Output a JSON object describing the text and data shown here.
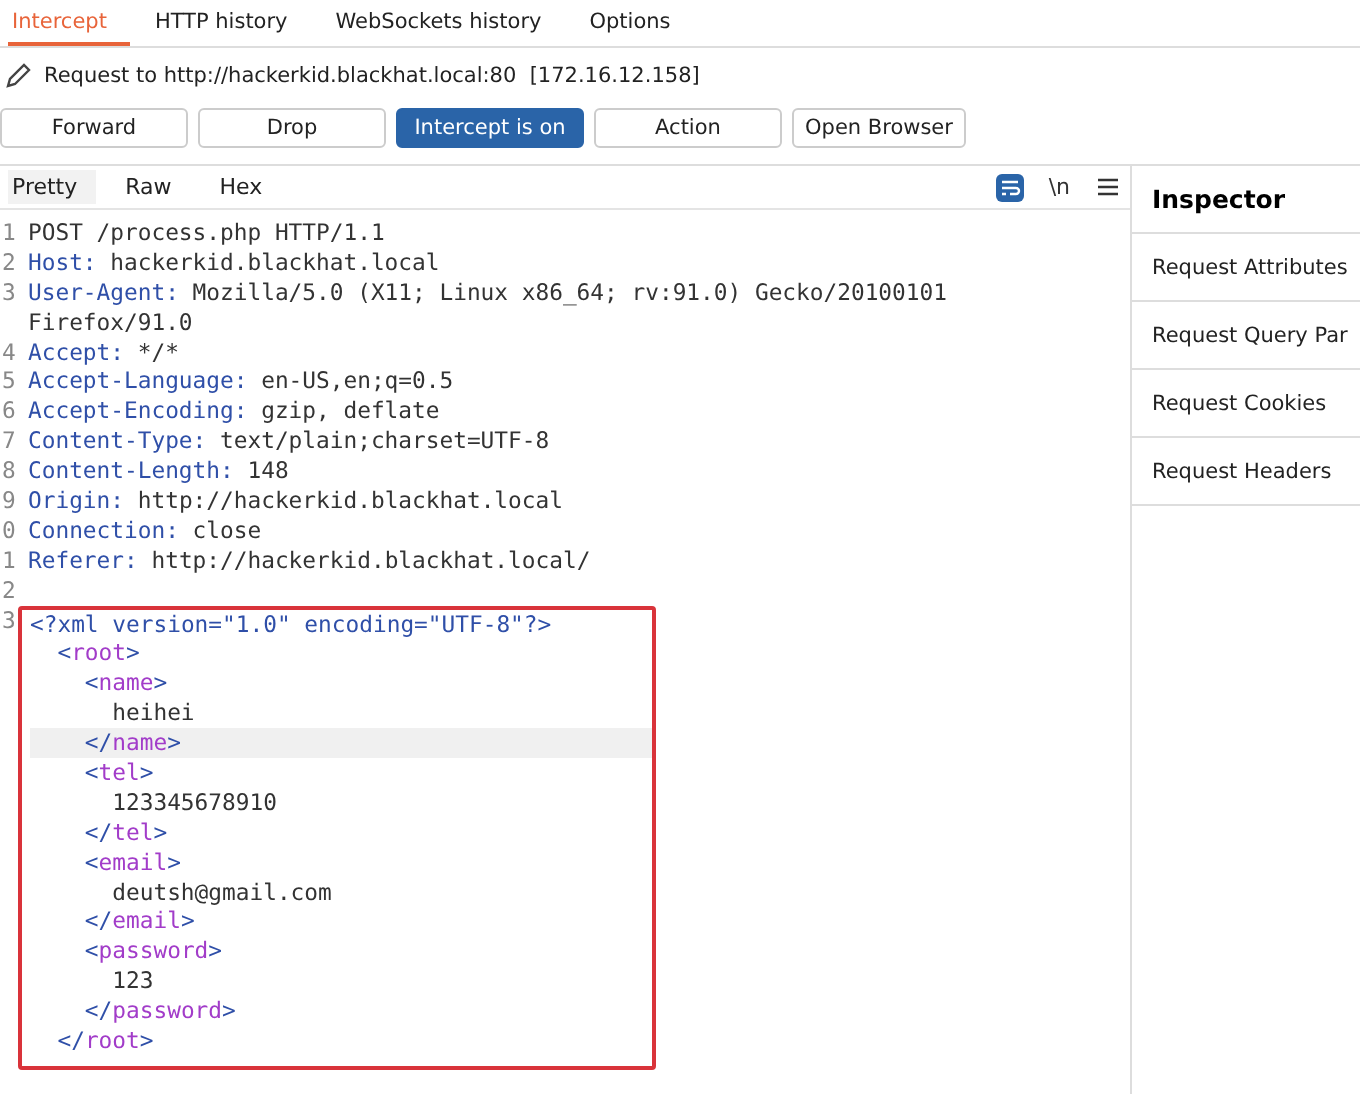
{
  "tabs": [
    {
      "label": "Intercept",
      "selected": true
    },
    {
      "label": "HTTP history",
      "selected": false
    },
    {
      "label": "WebSockets history",
      "selected": false
    },
    {
      "label": "Options",
      "selected": false
    }
  ],
  "request_info": "Request to http://hackerkid.blackhat.local:80  [172.16.12.158]",
  "buttons": [
    {
      "label": "Forward",
      "selected": false
    },
    {
      "label": "Drop",
      "selected": false
    },
    {
      "label": "Intercept is on",
      "selected": true
    },
    {
      "label": "Action",
      "selected": false
    },
    {
      "label": "Open Browser",
      "selected": false
    }
  ],
  "editor_tabs": [
    {
      "label": "Pretty",
      "selected": true
    },
    {
      "label": "Raw",
      "selected": false
    },
    {
      "label": "Hex",
      "selected": false
    }
  ],
  "newline_toggle": "\\n",
  "header_lines": [
    {
      "number": "1",
      "segments": [
        {
          "kind": "text",
          "text": "POST /process.php HTTP/1.1"
        }
      ]
    },
    {
      "number": "2",
      "segments": [
        {
          "kind": "key",
          "text": "Host:"
        },
        {
          "kind": "text",
          "text": " hackerkid.blackhat.local"
        }
      ]
    },
    {
      "number": "3",
      "segments": [
        {
          "kind": "key",
          "text": "User-Agent:"
        },
        {
          "kind": "text",
          "text": " Mozilla/5.0 (X11; Linux x86_64; rv:91.0) Gecko/20100101"
        }
      ]
    },
    {
      "segments": [
        {
          "kind": "text",
          "text": "Firefox/91.0"
        }
      ]
    },
    {
      "number": "4",
      "segments": [
        {
          "kind": "key",
          "text": "Accept:"
        },
        {
          "kind": "text",
          "text": " */*"
        }
      ]
    },
    {
      "number": "5",
      "segments": [
        {
          "kind": "key",
          "text": "Accept-Language:"
        },
        {
          "kind": "text",
          "text": " en-US,en;q=0.5"
        }
      ]
    },
    {
      "number": "6",
      "segments": [
        {
          "kind": "key",
          "text": "Accept-Encoding:"
        },
        {
          "kind": "text",
          "text": " gzip, deflate"
        }
      ]
    },
    {
      "number": "7",
      "segments": [
        {
          "kind": "key",
          "text": "Content-Type:"
        },
        {
          "kind": "text",
          "text": " text/plain;charset=UTF-8"
        }
      ]
    },
    {
      "number": "8",
      "segments": [
        {
          "kind": "key",
          "text": "Content-Length:"
        },
        {
          "kind": "text",
          "text": " 148"
        }
      ]
    },
    {
      "number": "9",
      "segments": [
        {
          "kind": "key",
          "text": "Origin:"
        },
        {
          "kind": "text",
          "text": " http://hackerkid.blackhat.local"
        }
      ]
    },
    {
      "number": "0",
      "segments": [
        {
          "kind": "key",
          "text": "Connection:"
        },
        {
          "kind": "text",
          "text": " close"
        }
      ]
    },
    {
      "number": "1",
      "segments": [
        {
          "kind": "key",
          "text": "Referer:"
        },
        {
          "kind": "text",
          "text": " http://hackerkid.blackhat.local/"
        }
      ]
    },
    {
      "number": "2"
    }
  ],
  "body_number": "3",
  "body_lines": [
    {
      "highlighted": false,
      "segments": [
        {
          "kind": "bracket",
          "text": "<?xml "
        },
        {
          "kind": "key",
          "text": "version="
        },
        {
          "kind": "string",
          "text": "\"1.0\""
        },
        {
          "kind": "key",
          "text": " encoding="
        },
        {
          "kind": "string",
          "text": "\"UTF-8\""
        },
        {
          "kind": "bracket",
          "text": "?>"
        }
      ]
    },
    {
      "highlighted": false,
      "segments": [
        {
          "kind": "bracket",
          "text": "  <"
        },
        {
          "kind": "tag",
          "text": "root"
        },
        {
          "kind": "bracket",
          "text": ">"
        }
      ]
    },
    {
      "highlighted": false,
      "segments": [
        {
          "kind": "bracket",
          "text": "    <"
        },
        {
          "kind": "tag",
          "text": "name"
        },
        {
          "kind": "bracket",
          "text": ">"
        }
      ]
    },
    {
      "highlighted": false,
      "segments": [
        {
          "kind": "text",
          "text": "      heihei"
        }
      ]
    },
    {
      "highlighted": true,
      "segments": [
        {
          "kind": "bracket",
          "text": "    </"
        },
        {
          "kind": "tag",
          "text": "name"
        },
        {
          "kind": "bracket",
          "text": ">"
        }
      ]
    },
    {
      "highlighted": false,
      "segments": [
        {
          "kind": "bracket",
          "text": "    <"
        },
        {
          "kind": "tag",
          "text": "tel"
        },
        {
          "kind": "bracket",
          "text": ">"
        }
      ]
    },
    {
      "highlighted": false,
      "segments": [
        {
          "kind": "text",
          "text": "      123345678910"
        }
      ]
    },
    {
      "highlighted": false,
      "segments": [
        {
          "kind": "bracket",
          "text": "    </"
        },
        {
          "kind": "tag",
          "text": "tel"
        },
        {
          "kind": "bracket",
          "text": ">"
        }
      ]
    },
    {
      "highlighted": false,
      "segments": [
        {
          "kind": "bracket",
          "text": "    <"
        },
        {
          "kind": "tag",
          "text": "email"
        },
        {
          "kind": "bracket",
          "text": ">"
        }
      ]
    },
    {
      "highlighted": false,
      "segments": [
        {
          "kind": "text",
          "text": "      deutsh@gmail.com"
        }
      ]
    },
    {
      "highlighted": false,
      "segments": [
        {
          "kind": "bracket",
          "text": "    </"
        },
        {
          "kind": "tag",
          "text": "email"
        },
        {
          "kind": "bracket",
          "text": ">"
        }
      ]
    },
    {
      "highlighted": false,
      "segments": [
        {
          "kind": "bracket",
          "text": "    <"
        },
        {
          "kind": "tag",
          "text": "password"
        },
        {
          "kind": "bracket",
          "text": ">"
        }
      ]
    },
    {
      "highlighted": false,
      "segments": [
        {
          "kind": "text",
          "text": "      123"
        }
      ]
    },
    {
      "highlighted": false,
      "segments": [
        {
          "kind": "bracket",
          "text": "    </"
        },
        {
          "kind": "tag",
          "text": "password"
        },
        {
          "kind": "bracket",
          "text": ">"
        }
      ]
    },
    {
      "highlighted": false,
      "segments": [
        {
          "kind": "bracket",
          "text": "  </"
        },
        {
          "kind": "tag",
          "text": "root"
        },
        {
          "kind": "bracket",
          "text": ">"
        }
      ]
    }
  ],
  "inspector": {
    "title": "Inspector",
    "items": [
      "Request Attributes",
      "Request Query Par",
      "Request Cookies",
      "Request Headers"
    ]
  }
}
